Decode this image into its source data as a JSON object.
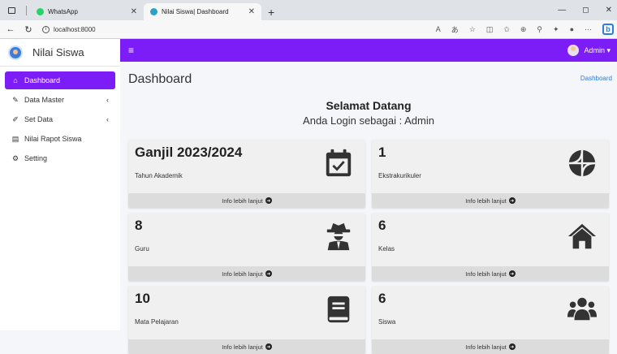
{
  "browser": {
    "tabs": [
      {
        "label": "WhatsApp"
      },
      {
        "label": "Nilai Siswa| Dashboard"
      }
    ],
    "url": "localhost:8000"
  },
  "sidebar": {
    "brand": "Nilai Siswa",
    "items": [
      {
        "label": "Dashboard",
        "icon": "home-icon"
      },
      {
        "label": "Data Master",
        "icon": "edit-icon"
      },
      {
        "label": "Set Data",
        "icon": "pencil-icon"
      },
      {
        "label": "Nilai Rapot Siswa",
        "icon": "file-icon"
      },
      {
        "label": "Setting",
        "icon": "gear-icon"
      }
    ]
  },
  "topnav": {
    "user_label": "Admin ▾"
  },
  "main": {
    "title": "Dashboard",
    "breadcrumb": "Dashboard",
    "welcome_title": "Selamat Datang",
    "welcome_sub": "Anda Login sebagai : Admin",
    "boxes": [
      {
        "value": "Ganjil 2023/2024",
        "label": "Tahun Akademik",
        "icon": "calendar-check-icon",
        "more": "Info lebih lanjut"
      },
      {
        "value": "1",
        "label": "Ekstrakurikuler",
        "icon": "basketball-icon",
        "more": "Info lebih lanjut"
      },
      {
        "value": "8",
        "label": "Guru",
        "icon": "user-secret-icon",
        "more": "Info lebih lanjut"
      },
      {
        "value": "6",
        "label": "Kelas",
        "icon": "home-icon",
        "more": "Info lebih lanjut"
      },
      {
        "value": "10",
        "label": "Mata Pelajaran",
        "icon": "book-icon",
        "more": "Info lebih lanjut"
      },
      {
        "value": "6",
        "label": "Siswa",
        "icon": "users-icon",
        "more": "Info lebih lanjut"
      }
    ]
  },
  "colors": {
    "accent": "#7c1cf6",
    "box_bg": "#f0f0f0",
    "box_footer": "#dcdcdc"
  }
}
